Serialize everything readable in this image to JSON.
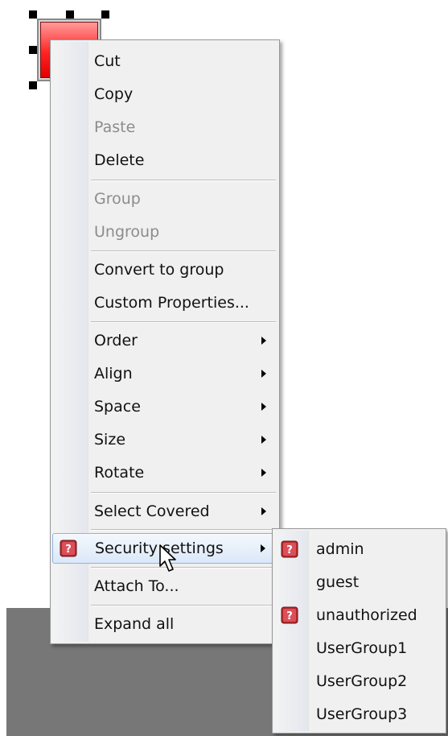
{
  "context_menu": {
    "items": [
      {
        "label": "Cut",
        "enabled": true
      },
      {
        "label": "Copy",
        "enabled": true
      },
      {
        "label": "Paste",
        "enabled": false
      },
      {
        "label": "Delete",
        "enabled": true
      },
      {
        "label": "Group",
        "enabled": false
      },
      {
        "label": "Ungroup",
        "enabled": false
      },
      {
        "label": "Convert to group",
        "enabled": true
      },
      {
        "label": "Custom Properties...",
        "enabled": true
      },
      {
        "label": "Order",
        "enabled": true,
        "submenu": true
      },
      {
        "label": "Align",
        "enabled": true,
        "submenu": true
      },
      {
        "label": "Space",
        "enabled": true,
        "submenu": true
      },
      {
        "label": "Size",
        "enabled": true,
        "submenu": true
      },
      {
        "label": "Rotate",
        "enabled": true,
        "submenu": true
      },
      {
        "label": "Select Covered",
        "enabled": true,
        "submenu": true
      },
      {
        "label": "Security settings",
        "enabled": true,
        "submenu": true,
        "highlighted": true,
        "icon": "security-shield-icon"
      },
      {
        "label": "Attach To...",
        "enabled": true
      },
      {
        "label": "Expand all",
        "enabled": true
      }
    ]
  },
  "security_submenu": {
    "items": [
      {
        "label": "admin",
        "icon": "security-shield-icon"
      },
      {
        "label": "guest"
      },
      {
        "label": "unauthorized",
        "icon": "security-shield-icon"
      },
      {
        "label": "UserGroup1"
      },
      {
        "label": "UserGroup2"
      },
      {
        "label": "UserGroup3"
      }
    ]
  },
  "colors": {
    "menu_background": "#f0f0f0",
    "highlight_border": "#8fb4e3",
    "component_red": "#ff2424",
    "workspace_gray": "#777777"
  }
}
